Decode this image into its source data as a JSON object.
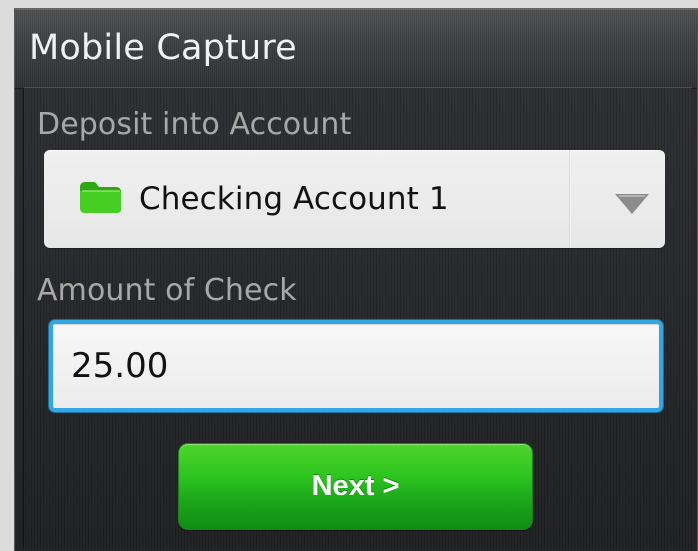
{
  "header": {
    "title": "Mobile Capture"
  },
  "deposit": {
    "label": "Deposit into Account",
    "selected_account": "Checking Account 1",
    "account_icon": "folder-icon",
    "dropdown_icon": "chevron-down-icon"
  },
  "amount": {
    "label": "Amount of Check",
    "value": "25.00"
  },
  "actions": {
    "next_label": "Next >"
  },
  "colors": {
    "primary_action": "#24b51f",
    "focus_border": "#33a7e4",
    "folder": "#39c51e"
  }
}
